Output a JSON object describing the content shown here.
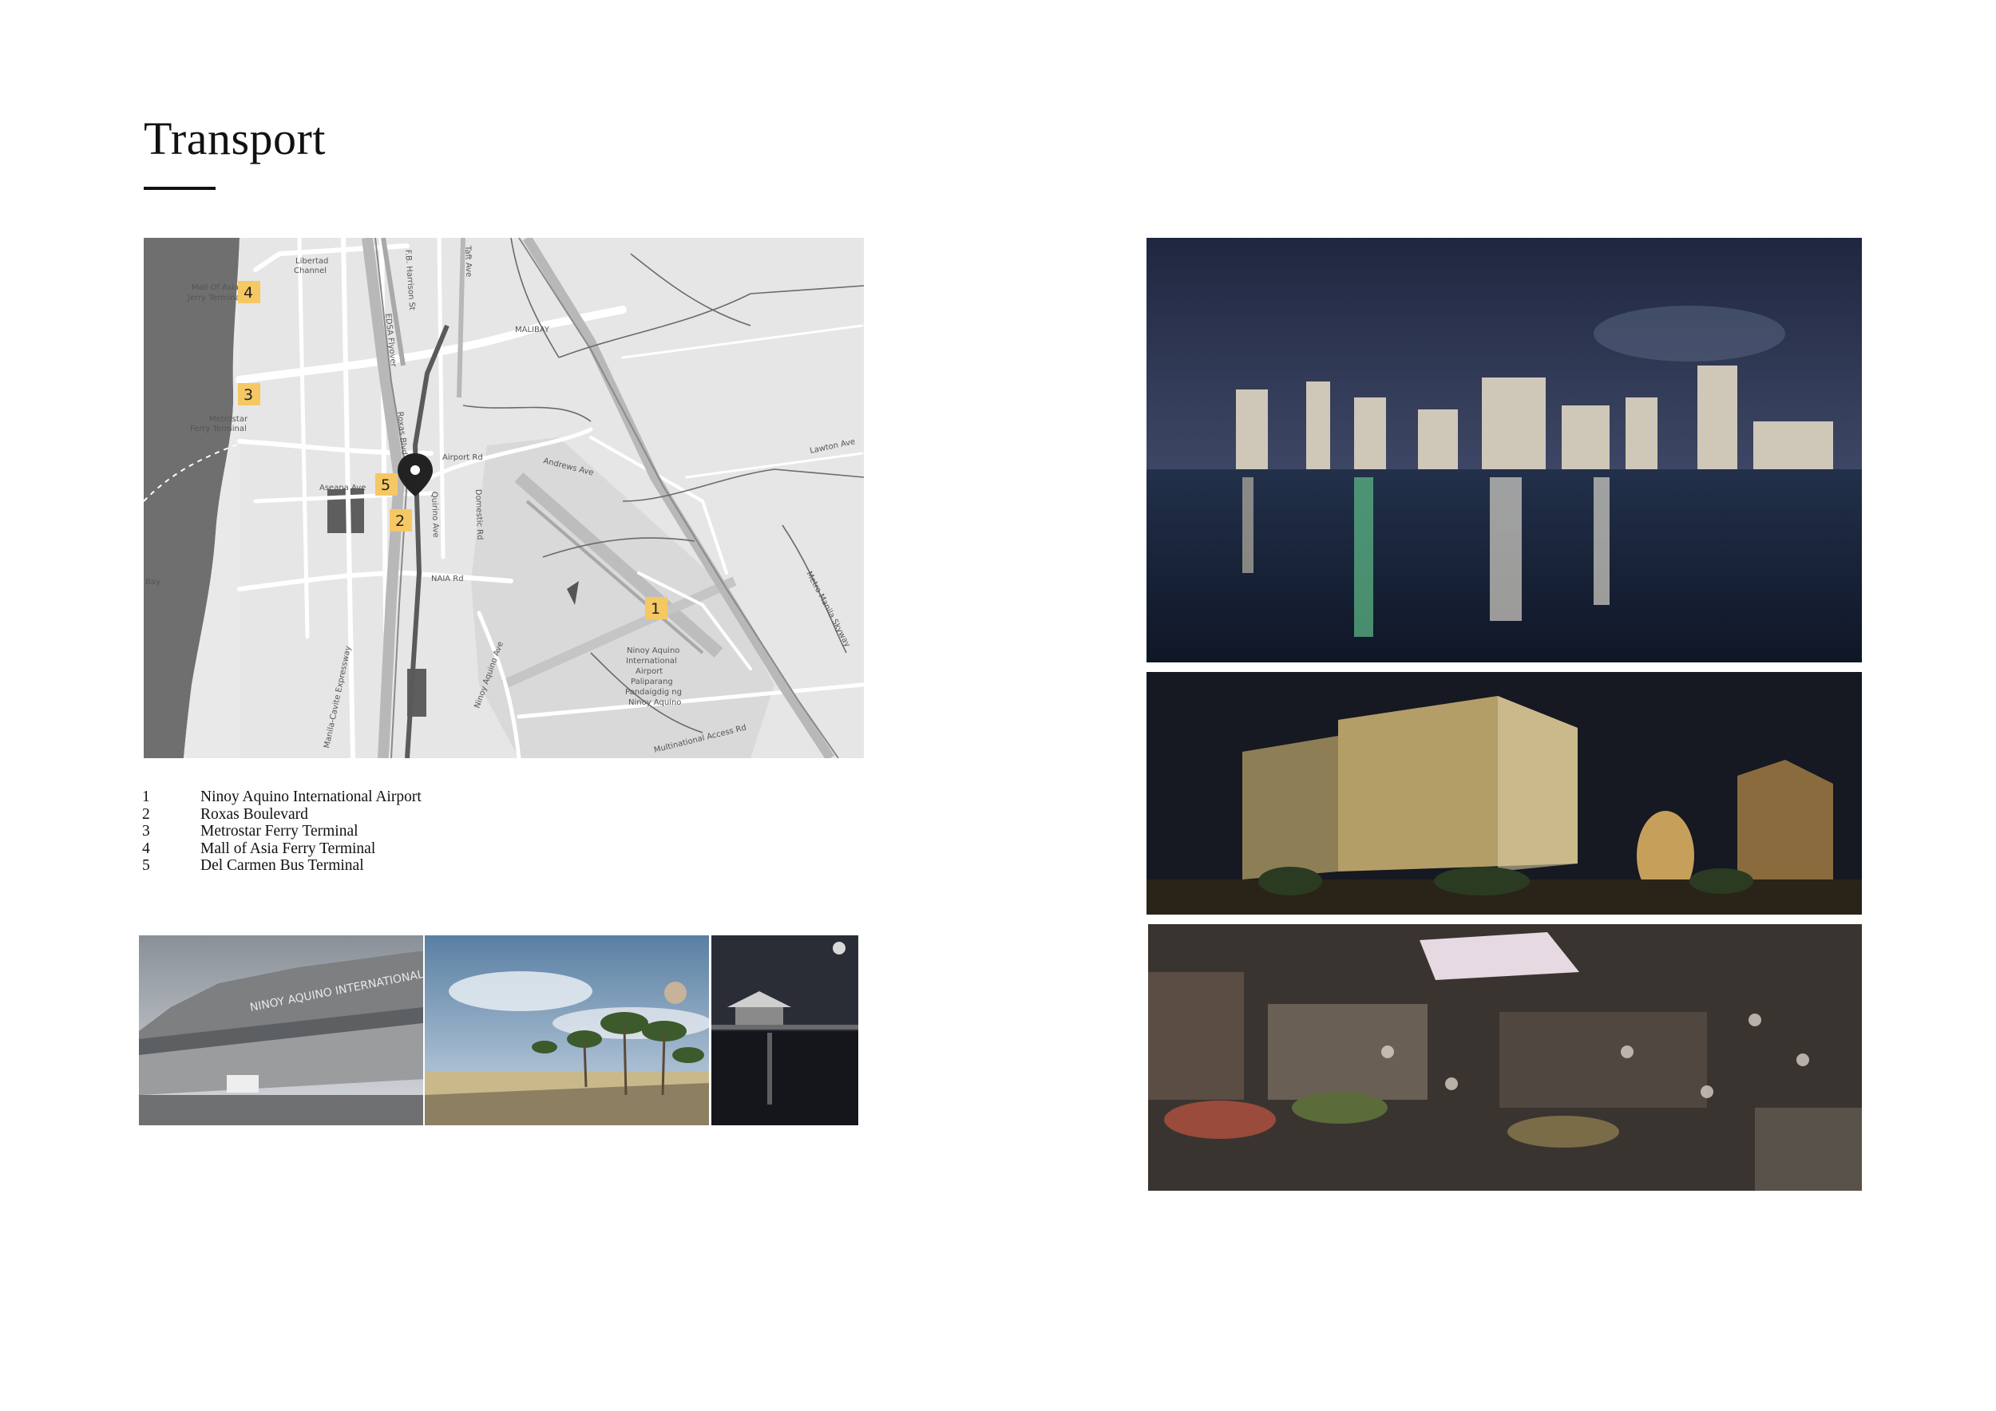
{
  "page": {
    "title": "Transport"
  },
  "map": {
    "labels": {
      "mall_of_asia": "Mall Of Asia",
      "ferry_terminal": "Jerry Terminal",
      "metrostar": "Metrostar",
      "metrostar_ferry": "Ferry Terminal",
      "libertad": "Libertad",
      "libertad2": "Channel",
      "edsa": "EDSA Flyover",
      "fb_harrison": "F.B. Harrison St",
      "taft": "Taft Ave",
      "malibay": "MALIBAY",
      "roxas": "Roxas Blvd",
      "quirino": "Quirino Ave",
      "domestic": "Domestic Rd",
      "andrews": "Andrews Ave",
      "aseana": "Aseana Ave",
      "naia_rd": "NAIA Rd",
      "bay": "Bay",
      "airport1": "Ninoy Aquino",
      "airport2": "International",
      "airport3": "Airport",
      "airport4": "Paliparang",
      "airport5": "Pandaigdig ng",
      "airport6": "Ninoy Aquino",
      "ninoy_ave": "Ninoy Aquino Ave",
      "cavite": "Manila-Cavite Expressway",
      "skyway": "Metro Manila Skyway",
      "access": "Multinational Access Rd",
      "lawton": "Lawton Ave",
      "airport_rd": "Airport Rd"
    },
    "markers": [
      {
        "num": "1"
      },
      {
        "num": "2"
      },
      {
        "num": "3"
      },
      {
        "num": "4"
      },
      {
        "num": "5"
      }
    ],
    "colors": {
      "marker": "#f6c863",
      "water": "#6f6f6f",
      "land": "#e9e9e9",
      "road": "#ffffff",
      "pin": "#222222"
    },
    "pin_icon": "location-pin-icon"
  },
  "legend": [
    {
      "num": "1",
      "label": "Ninoy Aquino International Airport"
    },
    {
      "num": "2",
      "label": "Roxas Boulevard"
    },
    {
      "num": "3",
      "label": "Metrostar Ferry Terminal"
    },
    {
      "num": "4",
      "label": "Mall of Asia Ferry Terminal"
    },
    {
      "num": "5",
      "label": "Del Carmen Bus Terminal"
    }
  ],
  "photos": {
    "airport": {
      "sign": "NINOY AQUINO INTERNATIONAL AIRPORT"
    }
  }
}
